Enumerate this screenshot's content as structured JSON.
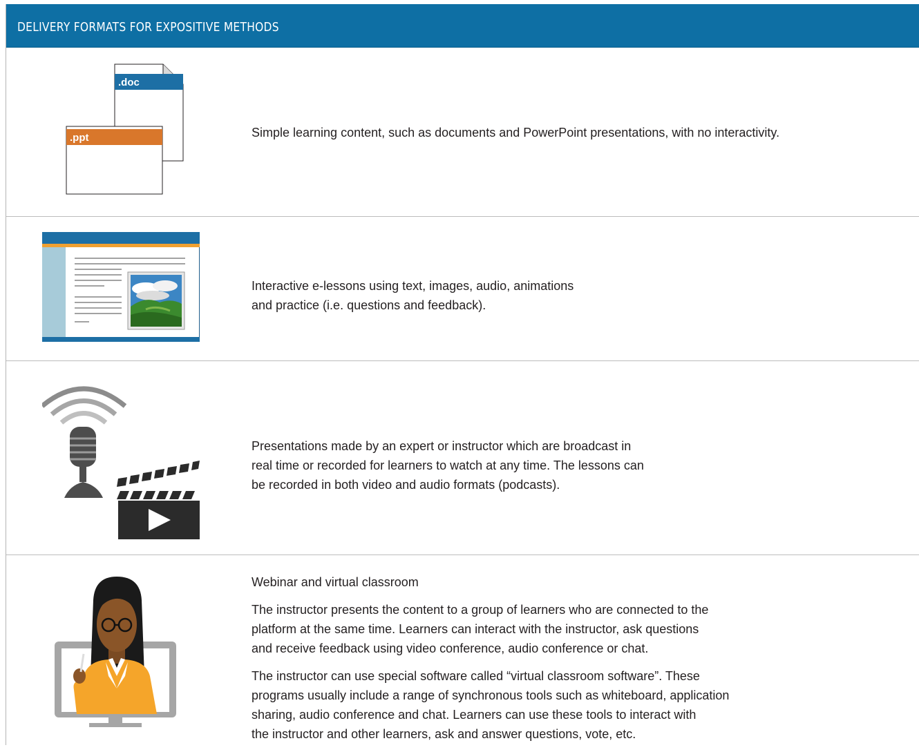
{
  "header": {
    "title": "DELIVERY FORMATS FOR EXPOSITIVE METHODS"
  },
  "rows": [
    {
      "icon": "documents-icon",
      "doc_label": ".doc",
      "ppt_label": ".ppt",
      "text": "Simple learning content, such as documents and PowerPoint presentations, with no interactivity."
    },
    {
      "icon": "e-lesson-screen-icon",
      "lines": [
        "Interactive e-lessons using text, images, audio, animations",
        "and practice (i.e. questions and feedback)."
      ]
    },
    {
      "icon": "microphone-clapperboard-icon",
      "lines": [
        "Presentations made by an expert or instructor which are broadcast  in",
        "real time or recorded for learners to watch at any time. The lessons can",
        "be recorded in both video and audio formats (podcasts)."
      ]
    },
    {
      "icon": "instructor-monitor-icon",
      "heading": "Webinar and virtual classroom",
      "para1": [
        "The instructor presents the content to a group of learners who are connected to the",
        "platform at the same time. Learners can interact with the instructor, ask questions",
        "and receive feedback using video conference, audio conference or chat."
      ],
      "para2": [
        "The instructor can use special software called “virtual classroom software”. These",
        "programs usually include a range of synchronous tools such as whiteboard, application",
        "sharing, audio conference and chat. Learners can use these tools to interact with",
        "the instructor and other learners, ask and answer questions, vote, etc."
      ]
    }
  ],
  "colors": {
    "header_bg": "#0e6fa4",
    "doc_blue": "#1d6fa5",
    "ppt_orange": "#d9772b",
    "instructor_orange": "#f5a52a"
  }
}
